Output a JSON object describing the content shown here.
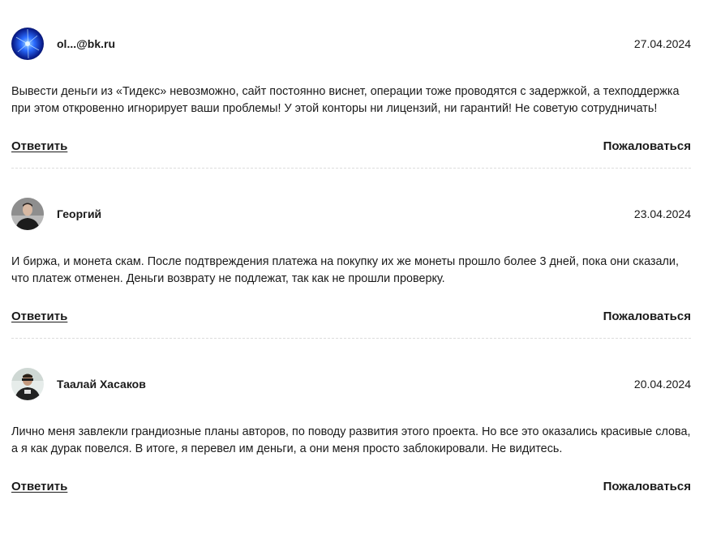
{
  "reviews": [
    {
      "author": "ol...@bk.ru",
      "date": "27.04.2024",
      "text": "Вывести деньги из «Тидекс» невозможно, сайт постоянно виснет, операции тоже проводятся с задержкой, а техподдержка при этом откровенно игнорирует ваши проблемы! У этой конторы ни лицензий, ни гарантий! Не советую сотрудничать!",
      "reply_label": "Ответить",
      "complain_label": "Пожаловаться"
    },
    {
      "author": "Георгий",
      "date": "23.04.2024",
      "text": "И биржа, и монета скам. После подтвреждения платежа на покупку их же монеты прошло более 3 дней, пока они сказали, что платеж отменен. Деньги возврату не подлежат, так как не прошли проверку.",
      "reply_label": "Ответить",
      "complain_label": "Пожаловаться"
    },
    {
      "author": "Таалай Хасаков",
      "date": "20.04.2024",
      "text": "Лично меня завлекли грандиозные планы авторов, по поводу развития этого проекта. Но все это оказались красивые слова, а я как дурак повелся. В итоге, я перевел им деньги, а они меня просто заблокировали. Не видитесь.",
      "reply_label": "Ответить",
      "complain_label": "Пожаловаться"
    }
  ]
}
